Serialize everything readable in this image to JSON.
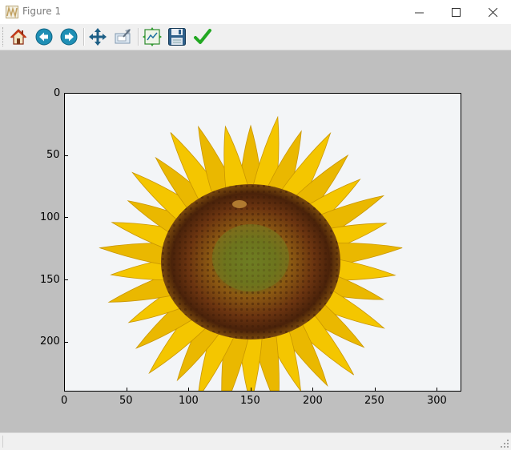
{
  "window": {
    "title": "Figure 1",
    "minimize_label": "—",
    "maximize_label": "☐",
    "close_label": "✕"
  },
  "toolbar": {
    "buttons": [
      {
        "name": "home",
        "icon": "home-icon"
      },
      {
        "name": "back",
        "icon": "back-arrow-icon"
      },
      {
        "name": "forward",
        "icon": "forward-arrow-icon"
      },
      {
        "name": "pan",
        "icon": "move-icon"
      },
      {
        "name": "zoom",
        "icon": "zoom-rect-icon"
      },
      {
        "name": "subplots",
        "icon": "configure-subplots-icon"
      },
      {
        "name": "save",
        "icon": "save-icon"
      },
      {
        "name": "edit",
        "icon": "checkmark-icon"
      }
    ]
  },
  "figure": {
    "background": "#bfbfbf",
    "image_content": "sunflower",
    "x_ticks": [
      "0",
      "50",
      "100",
      "150",
      "200",
      "250",
      "300"
    ],
    "y_ticks": [
      "0",
      "50",
      "100",
      "150",
      "200"
    ],
    "xlim": [
      0,
      320
    ],
    "ylim": [
      240,
      0
    ]
  },
  "colors": {
    "petal": "#f2c200",
    "petal_dark": "#d9a300",
    "disk_outer": "#5a2d0c",
    "disk_mid": "#8a5a10",
    "disk_center": "#6e7a1e",
    "sky": "#f4f6f8"
  }
}
